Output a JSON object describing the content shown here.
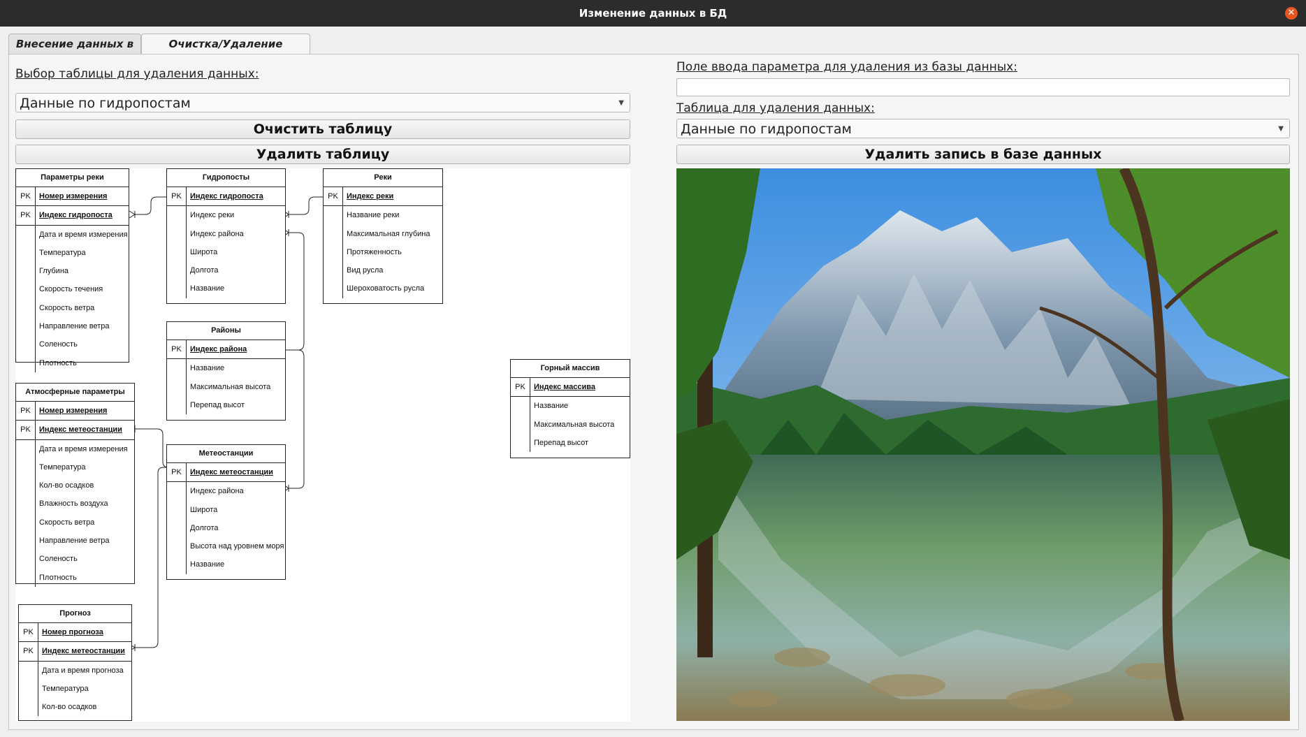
{
  "window": {
    "title": "Изменение данных в БД"
  },
  "tabs": [
    {
      "label": "Внесение данных в БД"
    },
    {
      "label": "Очистка/Удаление таблицы"
    }
  ],
  "left": {
    "select_label": "Выбор таблицы для удаления данных:",
    "select_value": "Данные по гидропостам",
    "clear_button": "Очистить таблицу",
    "delete_button": "Удалить таблицу"
  },
  "right": {
    "param_label": "Поле ввода параметра для  удаления из базы данных:",
    "param_value": "",
    "table_label": "Таблица для удаления данных:",
    "table_value": "Данные по гидропостам",
    "delete_record_button": "Удалить запись в базе данных"
  },
  "erd": {
    "river_params": {
      "title": "Параметры реки",
      "pk": [
        "Номер измерения",
        "Индекс гидропоста"
      ],
      "fields": [
        "Дата и время измерения",
        "Температура",
        "Глубина",
        "Скорость течения",
        "Скорость ветра",
        "Направление ветра",
        "Соленость",
        "Плотность"
      ]
    },
    "hydroposts": {
      "title": "Гидропосты",
      "pk": [
        "Индекс гидропоста"
      ],
      "fields": [
        "Индекс реки",
        "Индекс района",
        "Широта",
        "Долгота",
        "Название"
      ]
    },
    "rivers": {
      "title": "Реки",
      "pk": [
        "Индекс реки"
      ],
      "fields": [
        "Название реки",
        "Максимальная глубина",
        "Протяженность",
        "Вид русла",
        "Шероховатость русла"
      ]
    },
    "districts": {
      "title": "Районы",
      "pk": [
        "Индекс района"
      ],
      "fields": [
        "Название",
        "Максимальная высота",
        "Перепад высот"
      ]
    },
    "atmo_params": {
      "title": "Атмосферные параметры",
      "pk": [
        "Номер измерения",
        "Индекс метеостанции"
      ],
      "fields": [
        "Дата и время измерения",
        "Температура",
        "Кол-во осадков",
        "Влажность воздуха",
        "Скорость ветра",
        "Направление ветра",
        "Соленость",
        "Плотность"
      ]
    },
    "meteostations": {
      "title": "Метеостанции",
      "pk": [
        "Индекс метеостанции"
      ],
      "fields": [
        "Индекс района",
        "Широта",
        "Долгота",
        "Высота над уровнем моря",
        "Название"
      ]
    },
    "mountains": {
      "title": "Горный массив",
      "pk": [
        "Индекс массива"
      ],
      "fields": [
        "Название",
        "Максимальная высота",
        "Перепад высот"
      ]
    },
    "forecast": {
      "title": "Прогноз",
      "pk": [
        "Номер прогноза",
        "Индекс метеостанции"
      ],
      "fields": [
        "Дата и время прогноза",
        "Температура",
        "Кол-во осадков"
      ]
    }
  },
  "pk_label": "PK"
}
